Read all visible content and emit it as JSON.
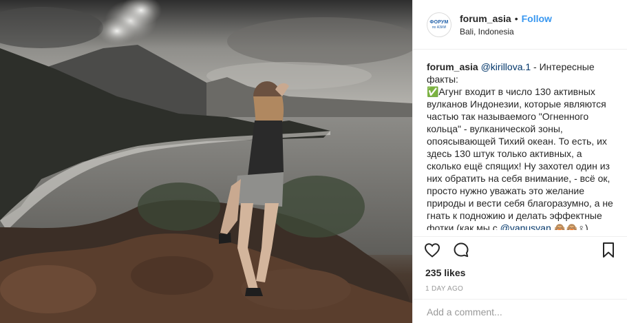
{
  "post": {
    "username": "forum_asia",
    "separator": "•",
    "follow_label": "Follow",
    "location": "Bali, Indonesia",
    "avatar_line1": "ФОРУМ",
    "avatar_line2": "по АЗИИ"
  },
  "caption": {
    "username": "forum_asia",
    "mention": "@kirillova.1",
    "text": " - Интересные факты:\n✅Агунг входит в число 130 активных вулканов Индонезии, которые являются частью так называемого \"Огненного кольца\" - вулканической зоны, опоясывающей Тихий океан. То есть, их здесь 130 штук только активных, а сколько ещё спящих! Ну захотел один из них обратить на себя внимание, - всё ок, просто нужно уважать это желание природы и вести себя благоразумно, а не гнать к подножию и делать эффектные фотки (как мы с ",
    "mention2": "@vanusvan",
    "tail": " 🙈🙈♀)"
  },
  "stats": {
    "likes": "235 likes",
    "time_ago": "1 DAY AGO"
  },
  "comment": {
    "placeholder": "Add a comment..."
  },
  "icons": {
    "like": "heart-icon",
    "comment": "comment-bubble-icon",
    "save": "bookmark-icon"
  }
}
